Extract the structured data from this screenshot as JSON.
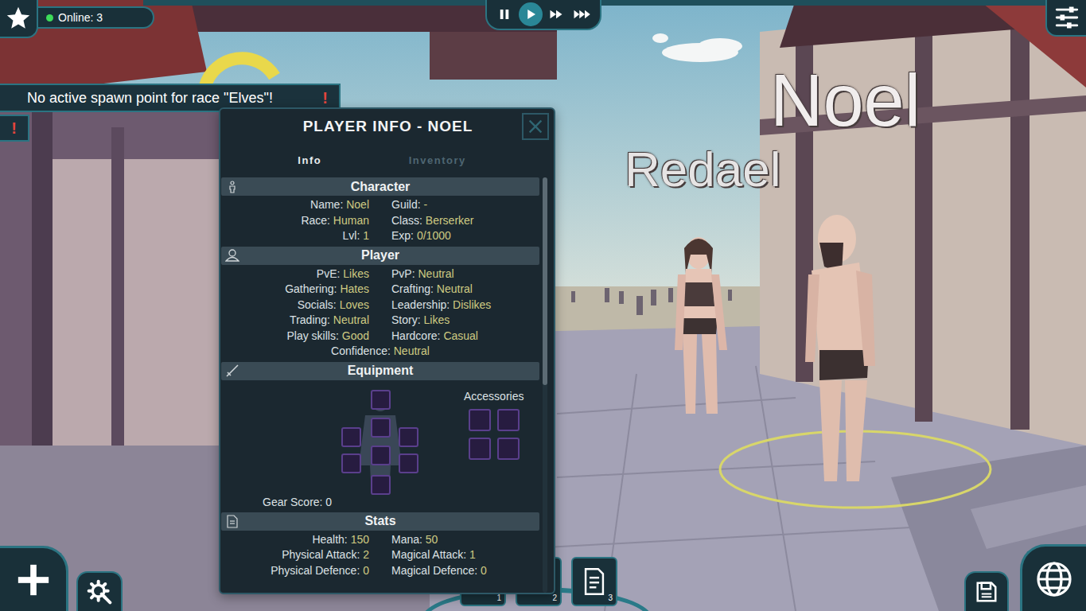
{
  "hud": {
    "online": "Online: 3",
    "alert": "No active spawn point for race \"Elves\"!",
    "alert_mark": "!",
    "side_mark": "!"
  },
  "playback": [
    {
      "kind": "pause",
      "selected": false
    },
    {
      "kind": "play",
      "selected": true
    },
    {
      "kind": "fast",
      "selected": false
    },
    {
      "kind": "faster",
      "selected": false
    }
  ],
  "nameplates": [
    "Noel",
    "Redael"
  ],
  "panel": {
    "title": "PLAYER INFO - NOEL",
    "tabs": [
      {
        "label": "Info",
        "selected": true
      },
      {
        "label": "Inventory",
        "selected": false
      }
    ],
    "scrollbar": {
      "level": 0.5
    },
    "sections": [
      {
        "kind": "character",
        "title": "Character",
        "rows": [
          [
            {
              "label": "Name:",
              "value": "Noel"
            },
            {
              "label": "Guild:",
              "value": "-"
            }
          ],
          [
            {
              "label": "Race:",
              "value": "Human"
            },
            {
              "label": "Class:",
              "value": "Berserker"
            }
          ],
          [
            {
              "label": "Lvl:",
              "value": "1"
            },
            {
              "label": "Exp:",
              "value": "0/1000"
            }
          ]
        ]
      },
      {
        "kind": "player",
        "title": "Player",
        "rows": [
          [
            {
              "label": "PvE:",
              "value": "Likes"
            },
            {
              "label": "PvP:",
              "value": "Neutral"
            }
          ],
          [
            {
              "label": "Gathering:",
              "value": "Hates"
            },
            {
              "label": "Crafting:",
              "value": "Neutral"
            }
          ],
          [
            {
              "label": "Socials:",
              "value": "Loves"
            },
            {
              "label": "Leadership:",
              "value": "Dislikes"
            }
          ],
          [
            {
              "label": "Trading:",
              "value": "Neutral"
            },
            {
              "label": "Story:",
              "value": "Likes"
            }
          ],
          [
            {
              "label": "Play skills:",
              "value": "Good"
            },
            {
              "label": "Hardcore:",
              "value": "Casual"
            }
          ],
          [
            {
              "label": "Confidence:",
              "value": "Neutral"
            }
          ]
        ]
      },
      {
        "kind": "equipment",
        "title": "Equipment",
        "accessories": "Accessories",
        "gear_score": "Gear Score: 0"
      },
      {
        "kind": "stats",
        "title": "Stats",
        "rows": [
          [
            {
              "label": "Health:",
              "value": "150"
            },
            {
              "label": "Mana:",
              "value": "50"
            }
          ],
          [
            {
              "label": "Physical Attack:",
              "value": "2"
            },
            {
              "label": "Magical Attack:",
              "value": "1"
            }
          ],
          [
            {
              "label": "Physical Defence:",
              "value": "0"
            },
            {
              "label": "Magical Defence:",
              "value": "0"
            }
          ]
        ]
      }
    ]
  },
  "toolbar": [
    {
      "label": "1",
      "kind": "group"
    },
    {
      "label": "2",
      "kind": "tools"
    },
    {
      "label": "3",
      "kind": "document"
    }
  ]
}
